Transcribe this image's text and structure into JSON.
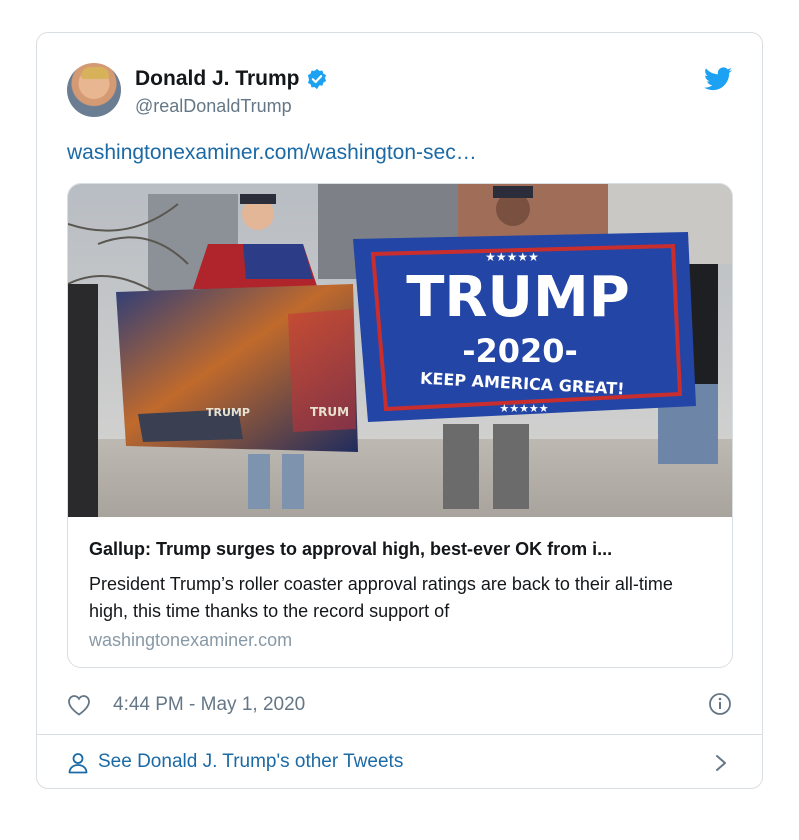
{
  "tweet": {
    "author_name": "Donald J. Trump",
    "author_handle": "@realDonaldTrump",
    "link_text": "washingtonexaminer.com/washington-sec…",
    "timestamp": "4:44 PM - May 1, 2020"
  },
  "card": {
    "title": "Gallup: Trump surges to approval high, best-ever OK from i...",
    "description": "President Trump’s roller coaster approval ratings are back to their all-time high, this time thanks to the record support of",
    "domain": "washingtonexaminer.com"
  },
  "photo": {
    "flag_main_text": "TRUMP",
    "flag_year_text": "-2020-",
    "flag_slogan_text": "KEEP AMERICA GREAT!",
    "flag_stars_text": "★★★★★",
    "left_flag_text_1": "TRUMP",
    "left_flag_text_2": "TRUM"
  },
  "footer": {
    "label": "See Donald J. Trump's other Tweets"
  },
  "icons": {
    "verified": "verified-badge-icon",
    "brand": "twitter-bird-icon",
    "like": "heart-icon",
    "info": "info-icon",
    "profile": "person-icon",
    "more": "chevron-right-icon"
  },
  "colors": {
    "brand": "#1da1f2",
    "link": "#1b6aa5",
    "secondary_text": "#657786",
    "border": "#d9dee2"
  }
}
